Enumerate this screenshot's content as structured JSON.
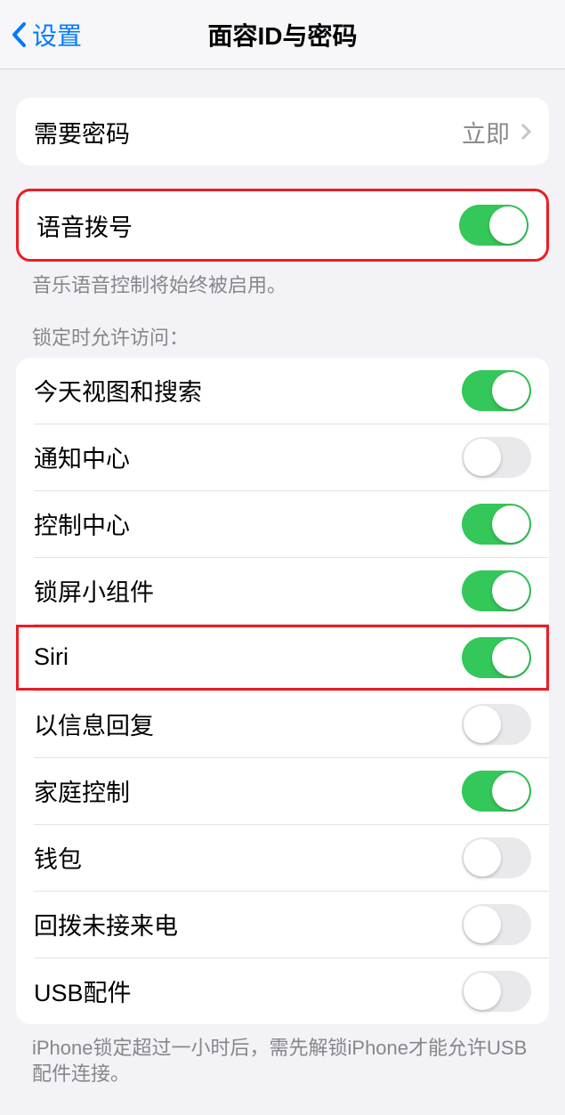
{
  "navbar": {
    "back_label": "设置",
    "title": "面容ID与密码"
  },
  "group1": {
    "require_passcode_label": "需要密码",
    "require_passcode_value": "立即"
  },
  "group2": {
    "voice_dial_label": "语音拨号",
    "voice_dial_on": true,
    "footer": "音乐语音控制将始终被启用。"
  },
  "group3": {
    "header": "锁定时允许访问：",
    "items": [
      {
        "label": "今天视图和搜索",
        "on": true,
        "highlighted": false
      },
      {
        "label": "通知中心",
        "on": false,
        "highlighted": false
      },
      {
        "label": "控制中心",
        "on": true,
        "highlighted": false
      },
      {
        "label": "锁屏小组件",
        "on": true,
        "highlighted": false
      },
      {
        "label": "Siri",
        "on": true,
        "highlighted": true
      },
      {
        "label": "以信息回复",
        "on": false,
        "highlighted": false
      },
      {
        "label": "家庭控制",
        "on": true,
        "highlighted": false
      },
      {
        "label": "钱包",
        "on": false,
        "highlighted": false
      },
      {
        "label": "回拨未接来电",
        "on": false,
        "highlighted": false
      },
      {
        "label": "USB配件",
        "on": false,
        "highlighted": false
      }
    ],
    "footer": "iPhone锁定超过一小时后，需先解锁iPhone才能允许USB配件连接。"
  }
}
